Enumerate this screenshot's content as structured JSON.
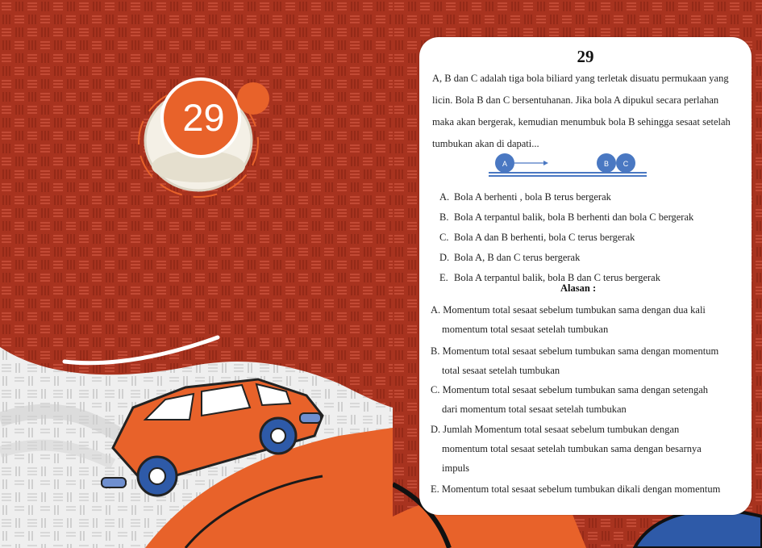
{
  "badge": {
    "number": "29",
    "accent": "#e8622a"
  },
  "card": {
    "number": "29",
    "question_lines": [
      "A, B dan C adalah tiga bola biliard yang terletak disuatu permukaan yang",
      "licin. Bola B dan C bersentuhanan. Jika bola A dipukul secara perlahan",
      "maka akan bergerak, kemudian menumbuk bola B sehingga sesaat setelah",
      "tumbukan akan di dapati..."
    ],
    "diagram": {
      "ball_a": "A",
      "ball_b": "B",
      "ball_c": "C",
      "ball_color": "#4a78c2"
    },
    "options": [
      {
        "letter": "A.",
        "text": "Bola A berhenti , bola B terus bergerak"
      },
      {
        "letter": "B.",
        "text": "Bola A terpantul balik, bola B berhenti dan bola C bergerak"
      },
      {
        "letter": "C.",
        "text": "Bola A dan B berhenti, bola C terus bergerak"
      },
      {
        "letter": "D.",
        "text": "Bola A, B dan C terus bergerak"
      },
      {
        "letter": "E.",
        "text": "Bola A terpantul balik, bola B dan C terus bergerak"
      }
    ],
    "alasan_title": "Alasan :",
    "reasons": [
      {
        "lines": [
          "A. Momentum total sesaat sebelum tumbukan sama dengan dua kali",
          "momentum total sesaat setelah tumbukan"
        ]
      },
      {
        "lines": [
          "B. Momentum total sesaat sebelum tumbukan sama dengan momentum",
          "total sesaat setelah tumbukan"
        ]
      },
      {
        "lines": [
          "C. Momentum total sesaat sebelum tumbukan sama dengan setengah",
          "dari  momentum total sesaat setelah tumbukan"
        ]
      },
      {
        "lines": [
          "D. Jumlah Momentum total sesaat sebelum tumbukan dengan",
          "momentum total sesaat setelah tumbukan sama dengan besarnya",
          "impuls"
        ]
      },
      {
        "lines": [
          "E. Momentum total sesaat sebelum tumbukan dikali dengan momentum"
        ]
      }
    ]
  },
  "colors": {
    "background_red": "#a8331f",
    "car_orange": "#e8622a",
    "wheel_blue": "#2e5aa8"
  }
}
